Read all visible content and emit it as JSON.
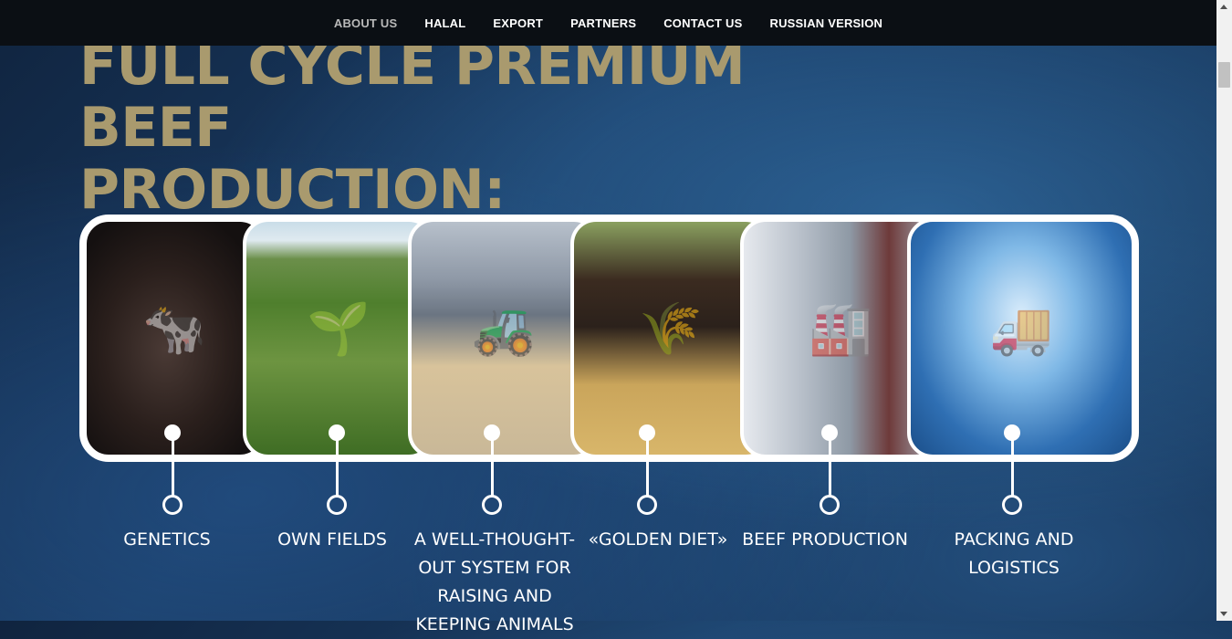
{
  "nav": {
    "items": [
      "ABOUT US",
      "HALAL",
      "EXPORT",
      "PARTNERS",
      "CONTACT US",
      "RUSSIAN VERSION"
    ]
  },
  "hero": {
    "headline_line1": "FULL CYCLE PREMIUM BEEF",
    "headline_line2": "PRODUCTION:"
  },
  "steps": [
    {
      "label": "GENETICS",
      "image": "cow-portrait"
    },
    {
      "label": "OWN FIELDS",
      "image": "crop-field"
    },
    {
      "label_lines": [
        "A WELL-THOUGHT-",
        "OUT SYSTEM FOR",
        "RAISING AND",
        "KEEPING ANIMALS"
      ],
      "image": "barn-tractor"
    },
    {
      "label": "«GOLDEN DIET»",
      "image": "cattle-feeding"
    },
    {
      "label": "BEEF PRODUCTION",
      "image": "meat-processing"
    },
    {
      "label_lines": [
        "PACKING AND",
        "LOGISTICS"
      ],
      "image": "truck-logistics"
    }
  ],
  "colors": {
    "headline": "#a99a6e",
    "navbar": "#0b0f14",
    "accent_white": "#ffffff"
  }
}
